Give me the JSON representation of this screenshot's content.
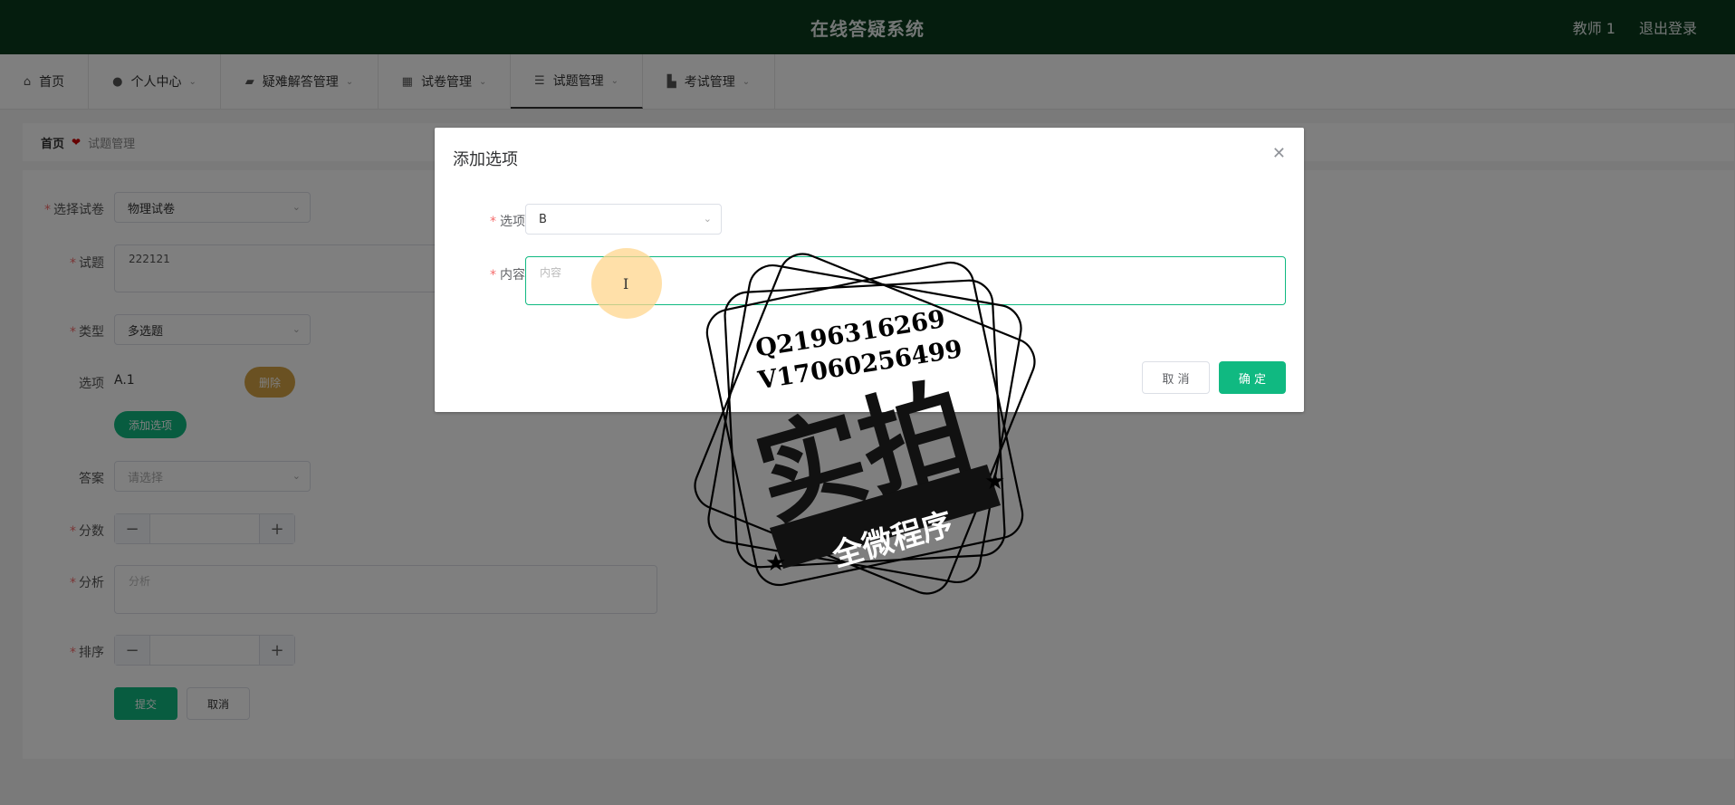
{
  "header": {
    "title": "在线答疑系统",
    "user": "教师 1",
    "logout": "退出登录"
  },
  "nav": {
    "items": [
      {
        "label": "首页",
        "icon": "home-icon",
        "has_dropdown": false
      },
      {
        "label": "个人中心",
        "icon": "person-icon",
        "has_dropdown": true
      },
      {
        "label": "疑难解答管理",
        "icon": "ticket-icon",
        "has_dropdown": true
      },
      {
        "label": "试卷管理",
        "icon": "grid-icon",
        "has_dropdown": true
      },
      {
        "label": "试题管理",
        "icon": "list-icon",
        "has_dropdown": true,
        "active": true
      },
      {
        "label": "考试管理",
        "icon": "briefcase-icon",
        "has_dropdown": true
      }
    ]
  },
  "breadcrumb": {
    "home": "首页",
    "current": "试题管理"
  },
  "form": {
    "paper_label": "选择试卷",
    "paper_value": "物理试卷",
    "question_label": "试题",
    "question_value": "222121",
    "type_label": "类型",
    "type_value": "多选题",
    "options_label": "选项",
    "option_item": "A.1",
    "delete_label": "删除",
    "add_option_label": "添加选项",
    "answer_label": "答案",
    "answer_placeholder": "请选择",
    "score_label": "分数",
    "analysis_label": "分析",
    "analysis_placeholder": "分析",
    "sort_label": "排序",
    "submit_label": "提交",
    "cancel_label": "取消",
    "stepper_minus": "−",
    "stepper_plus": "+"
  },
  "dialog": {
    "title": "添加选项",
    "option_label": "选项",
    "option_value": "B",
    "content_label": "内容",
    "content_placeholder": "内容",
    "cancel_label": "取 消",
    "confirm_label": "确 定"
  },
  "watermark": {
    "line1": "Q2196316269",
    "line2": "V17060256499",
    "main": "实拍",
    "banner": "全微程序"
  },
  "colors": {
    "topbar": "#0a3a1c",
    "primary": "#10b981",
    "danger": "#d4a245"
  }
}
